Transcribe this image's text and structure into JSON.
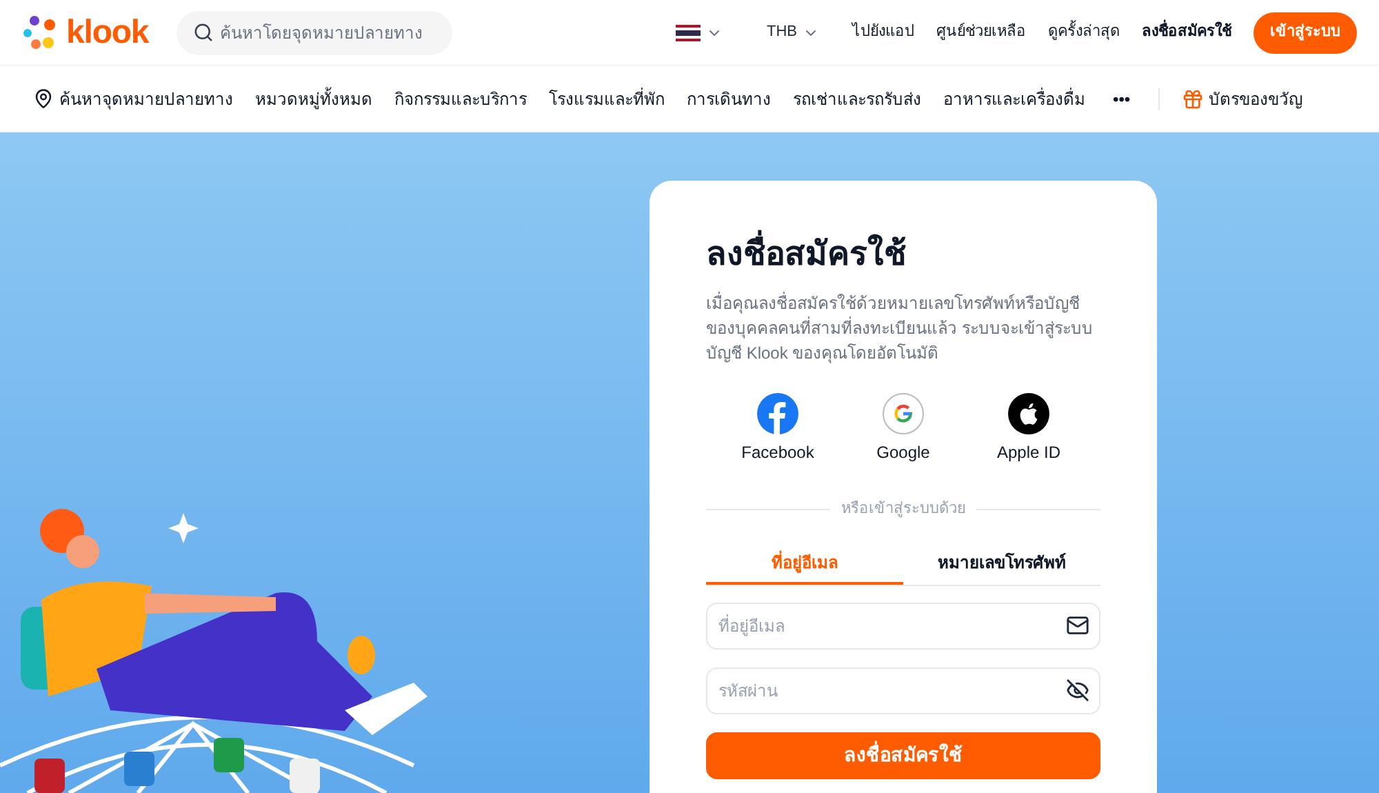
{
  "header": {
    "logo": "klook",
    "search": {
      "placeholder": "ค้นหาโดยจุดหมายปลายทาง"
    },
    "currency": "THB",
    "links": [
      {
        "label": "ไปยังแอป",
        "bold": false
      },
      {
        "label": "ศูนย์ช่วยเหลือ",
        "bold": false
      },
      {
        "label": "ดูครั้งล่าสุด",
        "bold": false
      },
      {
        "label": "ลงชื่อสมัครใช้",
        "bold": true
      }
    ],
    "login_button": "เข้าสู่ระบบ"
  },
  "nav": {
    "destination": "ค้นหาจุดหมายปลายทาง",
    "items": [
      "หมวดหมู่ทั้งหมด",
      "กิจกรรมและบริการ",
      "โรงแรมและที่พัก",
      "การเดินทาง",
      "รถเช่าและรถรับส่ง",
      "อาหารและเครื่องดื่ม"
    ],
    "more": "•••",
    "gift": "บัตรของขวัญ"
  },
  "signup": {
    "title": "ลงชื่อสมัครใช้",
    "description": "เมื่อคุณลงชื่อสมัครใช้ด้วยหมายเลขโทรศัพท์หรือบัญชีของบุคคลคนที่สามที่ลงทะเบียนแล้ว ระบบจะเข้าสู่ระบบบัญชี Klook ของคุณโดยอัตโนมัติ",
    "social": [
      {
        "kind": "facebook",
        "label": "Facebook"
      },
      {
        "kind": "google",
        "label": "Google"
      },
      {
        "kind": "apple",
        "label": "Apple ID"
      }
    ],
    "divider": "หรือเข้าสู่ระบบด้วย",
    "tabs": [
      {
        "label": "ที่อยู่อีเมล",
        "selected": true
      },
      {
        "label": "หมายเลขโทรศัพท์",
        "selected": false
      }
    ],
    "fields": [
      {
        "kind": "email",
        "placeholder": "ที่อยู่อีเมล"
      },
      {
        "kind": "password",
        "placeholder": "รหัสผ่าน"
      }
    ],
    "submit": "ลงชื่อสมัครใช้"
  }
}
